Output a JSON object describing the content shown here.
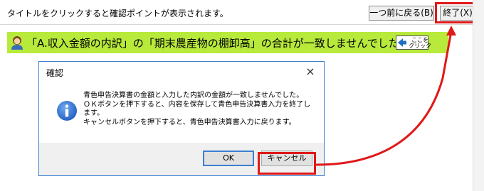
{
  "topbar": {
    "hint": "タイトルをクリックすると確認ポイントが表示されます。",
    "back_button": "一つ前に戻る(B)",
    "exit_button": "終了(X)"
  },
  "message": {
    "text": "「A.収入金額の内訳」の「期末農産物の棚卸高」の合計が一致しませんでした。",
    "here_label": "ここを\nクリック"
  },
  "dialog": {
    "title": "確認",
    "close": "×",
    "lines": [
      "青色申告決算書の金額と入力した内訳の金額が一致しませんでした。",
      "ＯＫボタンを押下すると、内容を保存して青色申告決算書入力を終了し",
      "ます。",
      "キャンセルボタンを押下すると、青色申告決算書入力に戻ります。"
    ],
    "ok": "OK",
    "cancel": "キャンセル"
  },
  "colors": {
    "message_bar": "#b8ea3c",
    "highlight": "#e01818",
    "dialog_border": "#3c7fd1",
    "info_icon": "#2e6fd0"
  }
}
